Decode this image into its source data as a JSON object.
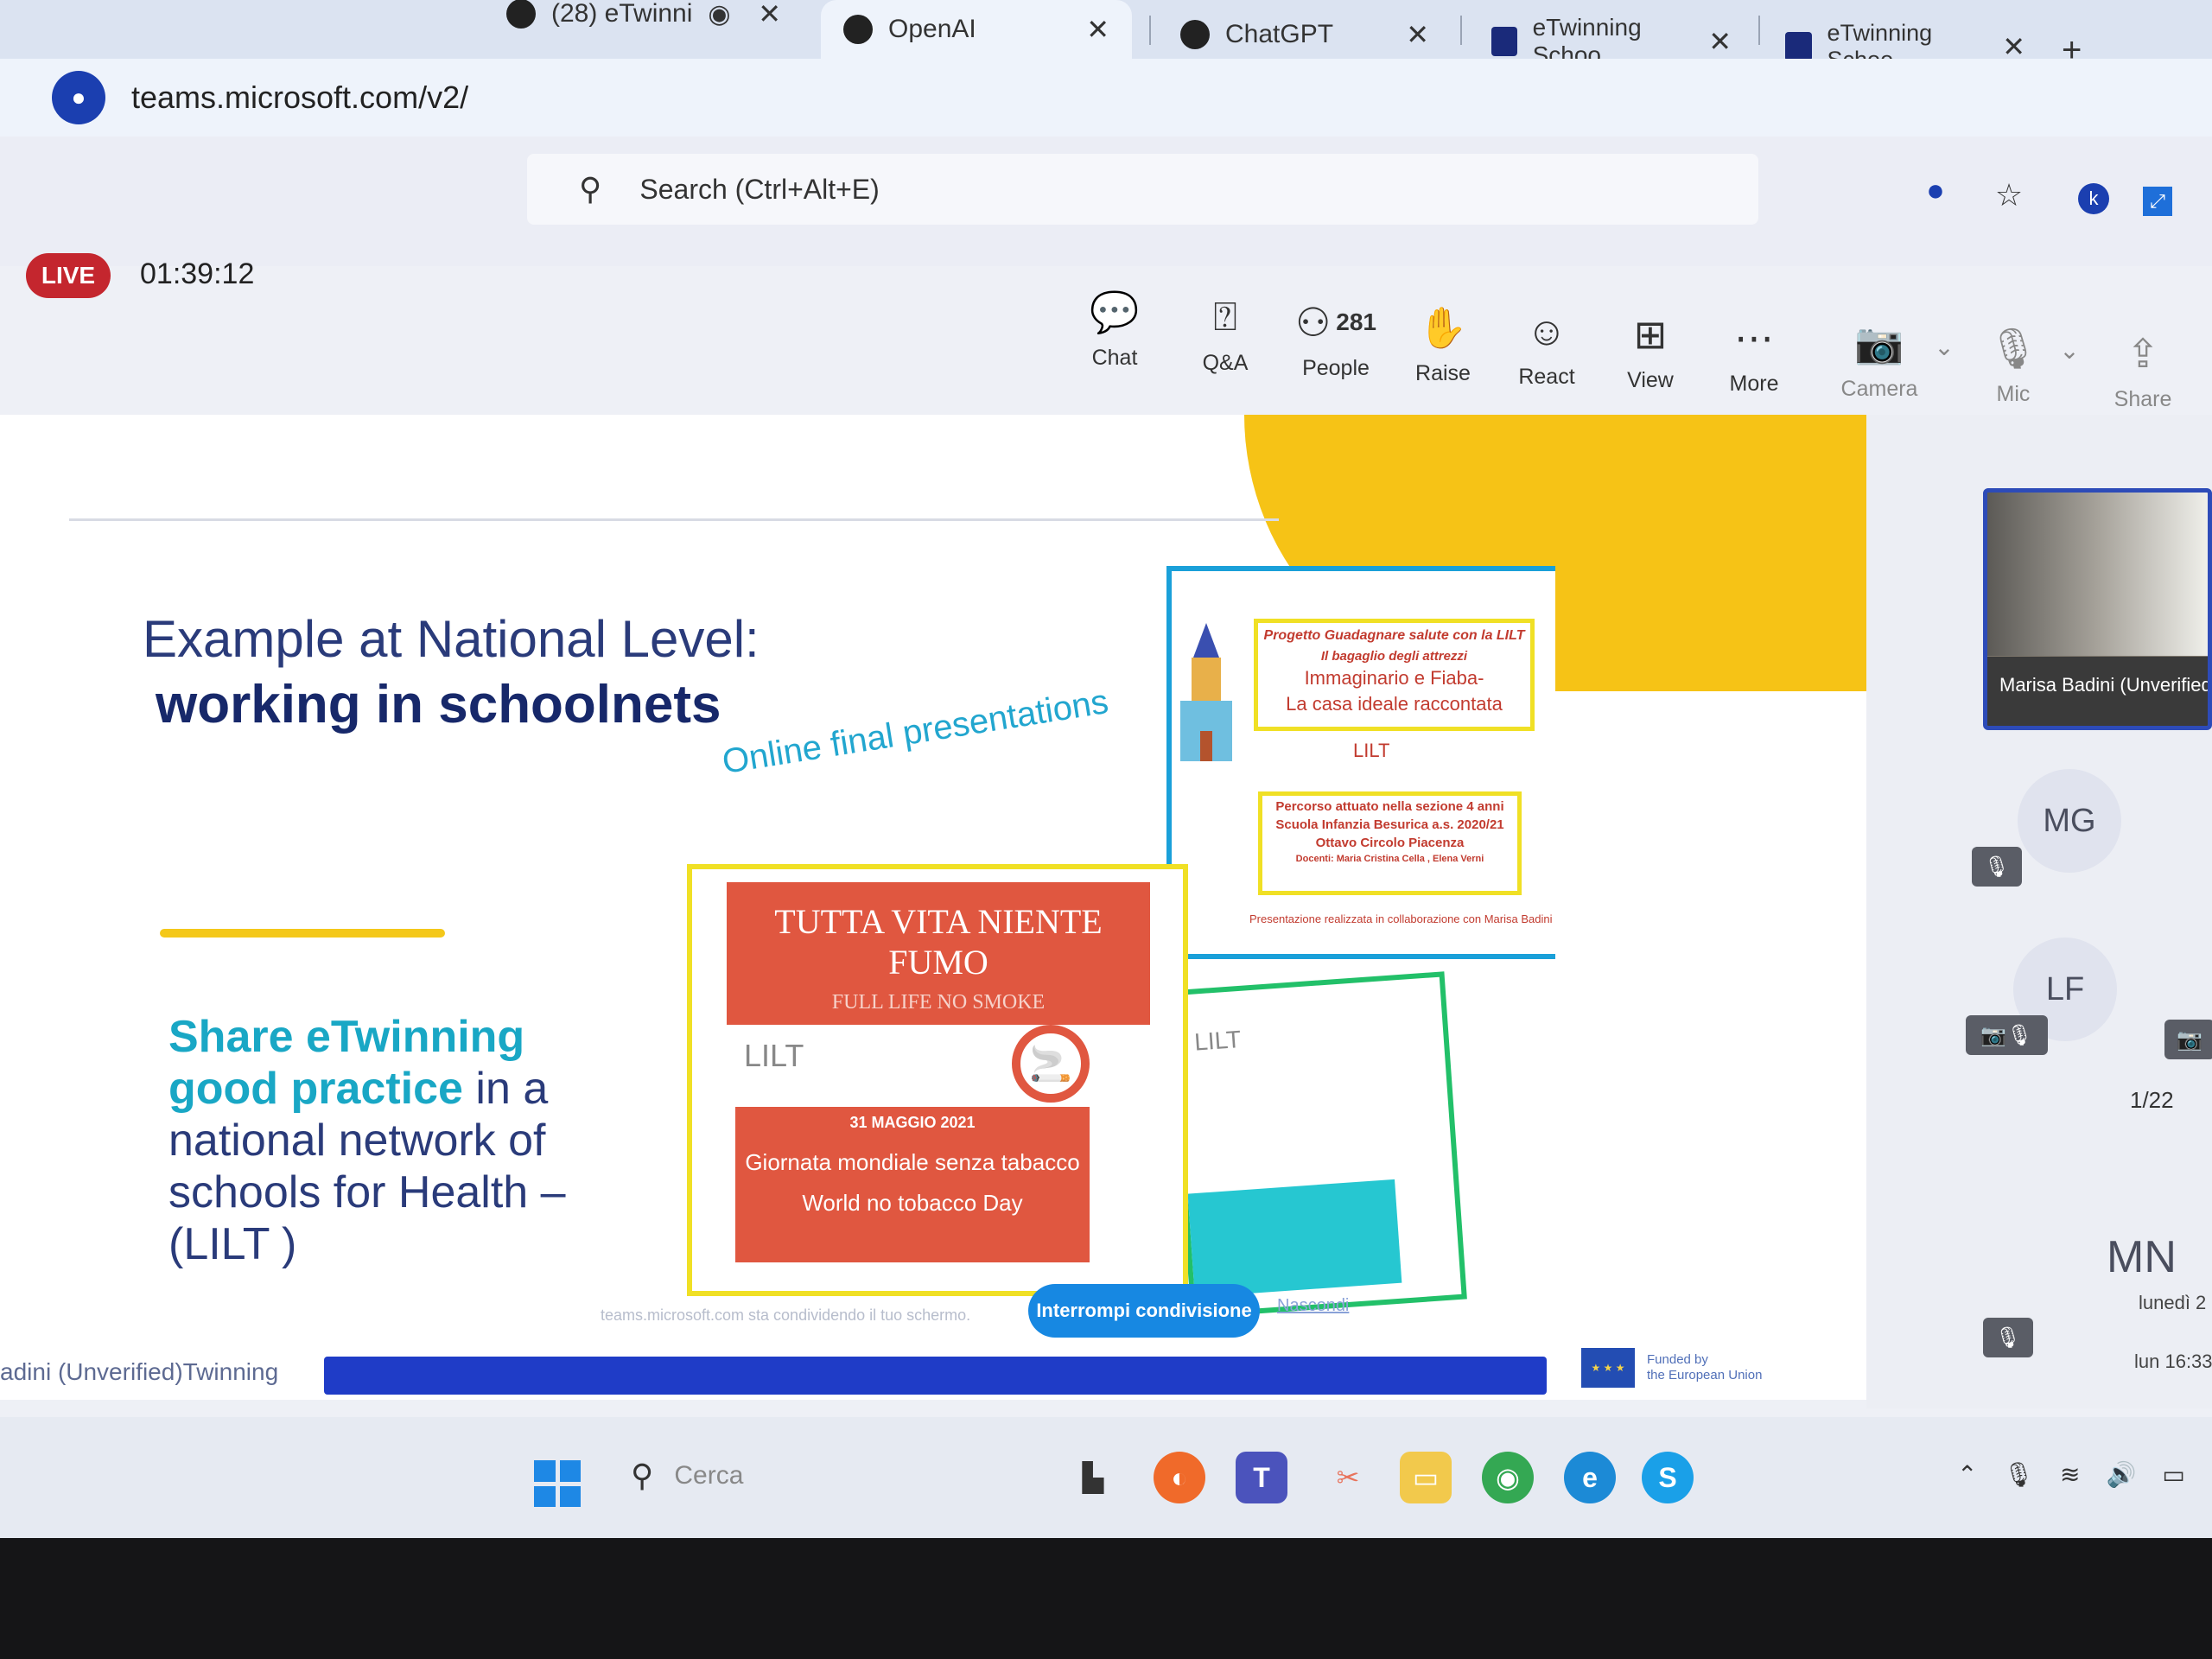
{
  "browser": {
    "tabs": [
      {
        "title": "(28) eTwinni",
        "active": false
      },
      {
        "title": "OpenAI",
        "active": true
      },
      {
        "title": "ChatGPT",
        "active": false
      },
      {
        "title": "eTwinning Schoo",
        "active": false
      },
      {
        "title": "eTwinning Schoo",
        "active": false
      }
    ],
    "new_tab": "+",
    "close_glyph": "✕",
    "url": "teams.microsoft.com/v2/"
  },
  "teams": {
    "search_placeholder": "Search (Ctrl+Alt+E)",
    "live_badge": "LIVE",
    "timer": "01:39:12",
    "people_count": "281",
    "toolbar": {
      "chat": "Chat",
      "qa": "Q&A",
      "people": "People",
      "raise": "Raise",
      "react": "React",
      "view": "View",
      "more": "More",
      "camera": "Camera",
      "mic": "Mic",
      "share": "Share"
    }
  },
  "slide": {
    "title_line1": "Example at National Level:",
    "title_line2": "working in schoolnets",
    "online_label": "Online final presentations",
    "share_hl1": "Share eTwinning",
    "share_hl2": "good practice",
    "share_rest1": " in a",
    "share_rest2": "national network of",
    "share_rest3": "schools for Health –",
    "share_rest4": "(LILT )",
    "poster1": {
      "headline": "TUTTA VITA NIENTE FUMO",
      "subhead": "FULL LIFE NO SMOKE",
      "logo": "LILT",
      "date": "31 MAGGIO 2021",
      "italian": "Giornata mondiale senza tabacco",
      "english": "World no tobacco Day"
    },
    "poster2": {
      "box1_line1": "Progetto Guadagnare salute con la LILT",
      "box1_line2": "Il bagaglio degli attrezzi",
      "box1_line3": "Immaginario e Fiaba-",
      "box1_line4": "La casa ideale raccontata",
      "logo": "LILT",
      "box2_line1": "Percorso attuato nella sezione 4 anni",
      "box2_line2": "Scuola Infanzia Besurica a.s. 2020/21",
      "box2_line3": "Ottavo Circolo Piacenza",
      "box2_line4": "Docenti: Maria Cristina Cella , Elena Verni",
      "credit": "Presentazione realizzata in collaborazione con Marisa Badini"
    },
    "poster3": {
      "logo": "LILT"
    },
    "sharing_notice": "teams.microsoft.com sta condividendo il tuo schermo.",
    "stop_sharing": "Interrompi condivisione",
    "hide": "Nascondi",
    "presenter_overlay": "adini (Unverified)",
    "etwinning_fragment": "Twinning",
    "funded_line1": "Funded by",
    "funded_line2": "the European Union"
  },
  "participants": {
    "video_name": "Marisa Badini (Unverified)",
    "avatar1": "MG",
    "avatar2": "LF",
    "avatar3": "MN",
    "page_indicator": "1/22",
    "time1": "lunedì 2",
    "time2": "lun 16:33"
  },
  "taskbar": {
    "search_placeholder": "Cerca",
    "apps": [
      "file-explorer",
      "firefox",
      "teams",
      "snipping-tool",
      "folder",
      "chrome",
      "edge",
      "skype"
    ]
  },
  "colors": {
    "live_red": "#c4262e",
    "slide_navy": "#17286a",
    "slide_teal": "#19a7c5",
    "accent_yellow": "#f4c81a",
    "progress_blue": "#1f3cc7",
    "stop_share_blue": "#1788e2",
    "poster_red": "#e05740"
  }
}
